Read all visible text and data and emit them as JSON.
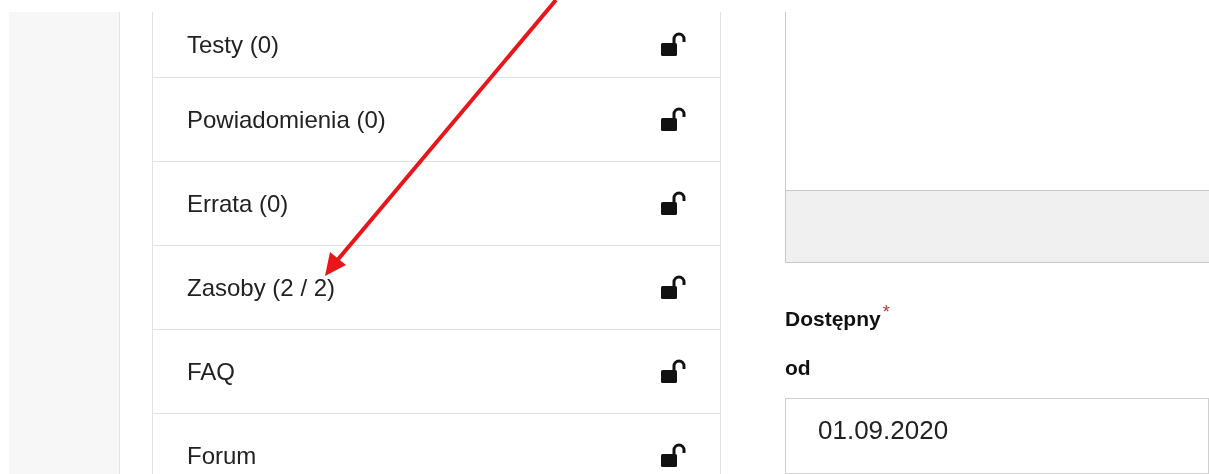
{
  "menu": {
    "items": [
      {
        "label": "Testy (0)",
        "locked": false
      },
      {
        "label": "Powiadomienia (0)",
        "locked": false
      },
      {
        "label": "Errata (0)",
        "locked": false
      },
      {
        "label": "Zasoby (2 / 2)",
        "locked": false
      },
      {
        "label": "FAQ",
        "locked": false
      },
      {
        "label": "Forum",
        "locked": false
      }
    ]
  },
  "form": {
    "label": "Dostępny",
    "required_mark": "*",
    "sublabel": "od",
    "value": "01.09.2020"
  }
}
